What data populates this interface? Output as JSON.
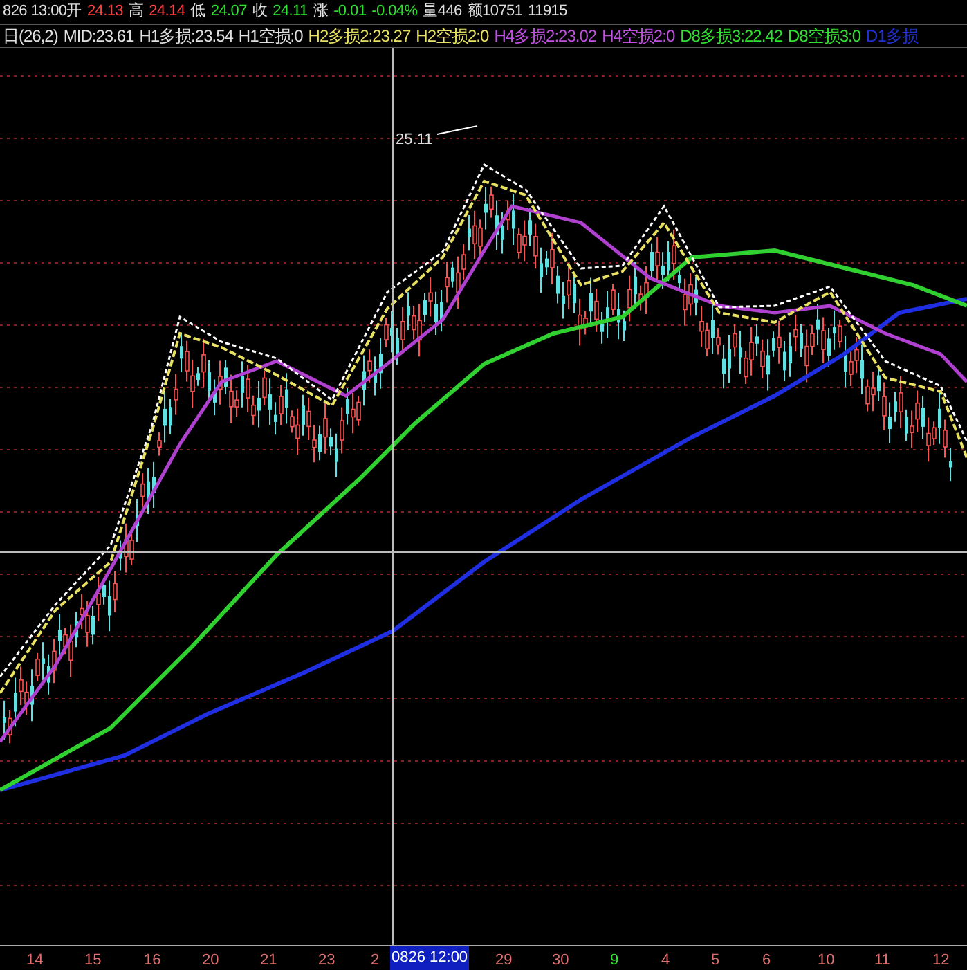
{
  "quote_bar": [
    {
      "text": "826 13:00开",
      "color": "#e0e0e0"
    },
    {
      "text": "24.13",
      "color": "#ff4040"
    },
    {
      "text": "高",
      "color": "#e0e0e0"
    },
    {
      "text": "24.14",
      "color": "#ff4040"
    },
    {
      "text": "低",
      "color": "#e0e0e0"
    },
    {
      "text": "24.07",
      "color": "#30e030"
    },
    {
      "text": "收",
      "color": "#e0e0e0"
    },
    {
      "text": "24.11",
      "color": "#30e030"
    },
    {
      "text": "涨",
      "color": "#e0e0e0"
    },
    {
      "text": "-0.01",
      "color": "#30e030"
    },
    {
      "text": "-0.04%",
      "color": "#30e030"
    },
    {
      "text": "量446",
      "color": "#e0e0e0"
    },
    {
      "text": "额10751",
      "color": "#e0e0e0"
    },
    {
      "text": "11915",
      "color": "#e0e0e0"
    }
  ],
  "indicator_bar": [
    {
      "text": "日(26,2)",
      "color": "#e0e0e0"
    },
    {
      "text": "MID:23.61",
      "color": "#e0e0e0"
    },
    {
      "text": "H1多损:23.54",
      "color": "#e0e0e0"
    },
    {
      "text": "H1空损:0",
      "color": "#e0e0e0"
    },
    {
      "text": "H2多损2:23.27",
      "color": "#e8e060"
    },
    {
      "text": "H2空损2:0",
      "color": "#e8e060"
    },
    {
      "text": "H4多损2:23.02",
      "color": "#c050e0"
    },
    {
      "text": "H4空损2:0",
      "color": "#c050e0"
    },
    {
      "text": "D8多损3:22.42",
      "color": "#30e030"
    },
    {
      "text": "D8空损3:0",
      "color": "#30e030"
    },
    {
      "text": "D1多损",
      "color": "#2030d0"
    }
  ],
  "price_label": "25.11",
  "cursor_time": "0826 12:00",
  "x_axis": [
    {
      "text": "14",
      "color": "#e07070"
    },
    {
      "text": "15",
      "color": "#e07070"
    },
    {
      "text": "16",
      "color": "#e07070"
    },
    {
      "text": "20",
      "color": "#e07070"
    },
    {
      "text": "21",
      "color": "#e07070"
    },
    {
      "text": "23",
      "color": "#e07070"
    },
    {
      "text": "2",
      "color": "#e07070"
    },
    {
      "text": "29",
      "color": "#e07070"
    },
    {
      "text": "30",
      "color": "#e07070"
    },
    {
      "text": "9",
      "color": "#30e030"
    },
    {
      "text": "4",
      "color": "#e07070"
    },
    {
      "text": "5",
      "color": "#e07070"
    },
    {
      "text": "6",
      "color": "#e07070"
    },
    {
      "text": "10",
      "color": "#e07070"
    },
    {
      "text": "11",
      "color": "#e07070"
    },
    {
      "text": "12",
      "color": "#e07070"
    }
  ]
}
